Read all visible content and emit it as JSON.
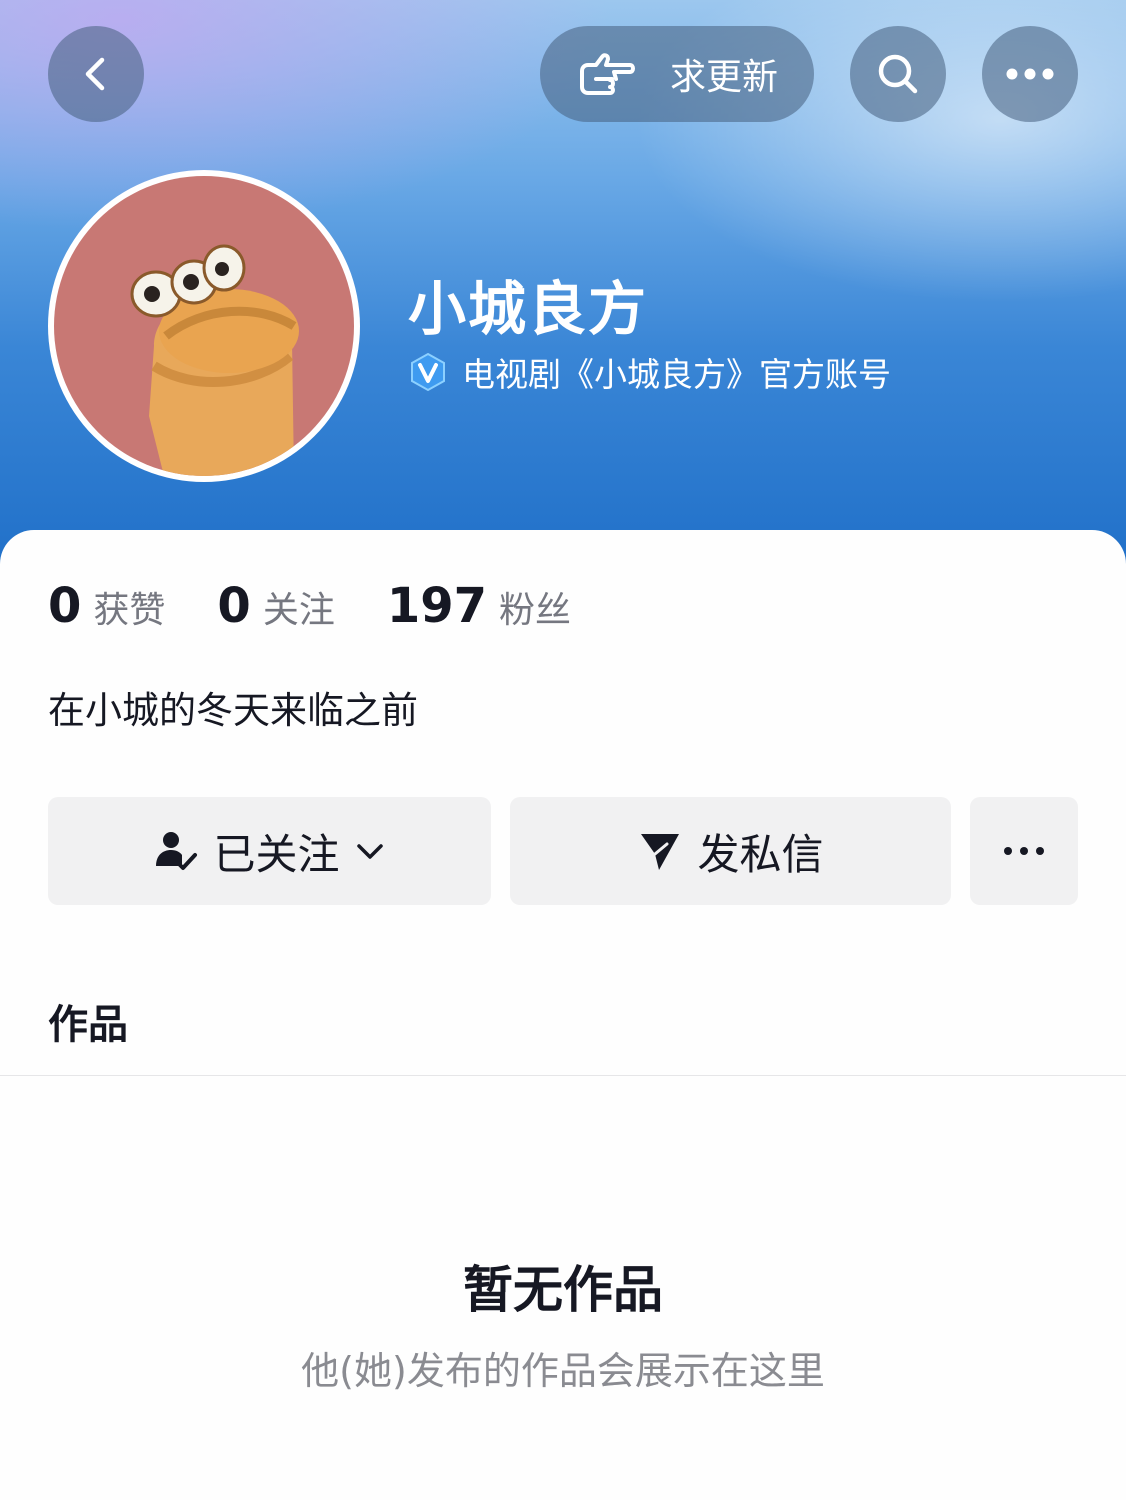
{
  "header": {
    "request_update_label": "求更新"
  },
  "profile": {
    "name": "小城良方",
    "verification": "电视剧《小城良方》官方账号",
    "stats": [
      {
        "value": "0",
        "label": "获赞"
      },
      {
        "value": "0",
        "label": "关注"
      },
      {
        "value": "197",
        "label": "粉丝"
      }
    ],
    "bio": "在小城的冬天来临之前"
  },
  "actions": {
    "follow_label": "已关注",
    "message_label": "发私信"
  },
  "tabs": {
    "works_label": "作品"
  },
  "empty_state": {
    "title": "暂无作品",
    "subtitle": "他(她)发布的作品会展示在这里"
  },
  "colors": {
    "header_top": "#9cc7ee",
    "header_bottom": "#1f6fc8",
    "avatar_bg": "#c87874",
    "button_bg": "#f1f1f2",
    "text_primary": "#161823",
    "text_secondary": "#757780"
  },
  "icons": [
    "back-arrow-icon",
    "pointing-hand-icon",
    "search-icon",
    "more-horizontal-icon",
    "verified-v-icon",
    "user-check-icon",
    "chevron-down-icon",
    "send-icon"
  ]
}
